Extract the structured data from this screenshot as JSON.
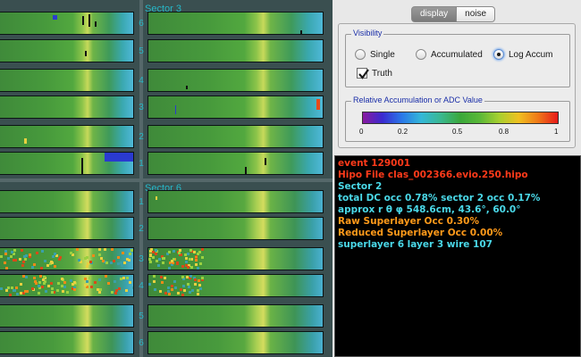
{
  "sectors": {
    "top_left_title": "",
    "top_right_title": "Sector 3",
    "bottom_left_title": "",
    "bottom_right_title": "Sector 6",
    "top_layers": [
      "6",
      "5",
      "4",
      "3",
      "2",
      "1"
    ],
    "bottom_layers": [
      "1",
      "2",
      "3",
      "4",
      "5",
      "6"
    ]
  },
  "tabs": {
    "display": "display",
    "noise": "noise"
  },
  "visibility": {
    "title": "Visibility",
    "options": [
      "Single",
      "Accumulated",
      "Log Accum"
    ],
    "selected": "Log Accum",
    "truth_label": "Truth",
    "truth_checked": true
  },
  "colorscale": {
    "title": "Relative Accumulation or ADC Value",
    "ticks": [
      "0",
      "0.2",
      "0.5",
      "0.8",
      "1"
    ],
    "tick_values": [
      0,
      0.2,
      0.5,
      0.8,
      1
    ]
  },
  "console": [
    {
      "text": "event 129001",
      "color": "#ff3a1a"
    },
    {
      "text": "Hipo File clas_002366.evio.250.hipo",
      "color": "#ff3a1a"
    },
    {
      "text": "Sector 2",
      "color": "#4ad8e8"
    },
    {
      "text": "total DC occ 0.78% sector 2 occ 0.17%",
      "color": "#4ad8e8"
    },
    {
      "text": "approx r θ φ 548.6cm, 43.6°, 60.0°",
      "color": "#4ad8e8"
    },
    {
      "text": "Raw Superlayer Occ 0.30%",
      "color": "#ff9a1a"
    },
    {
      "text": "Reduced Superlayer Occ 0.00%",
      "color": "#ff9a1a"
    },
    {
      "text": "superlayer 6  layer 3  wire 107",
      "color": "#4ad8e8"
    }
  ]
}
